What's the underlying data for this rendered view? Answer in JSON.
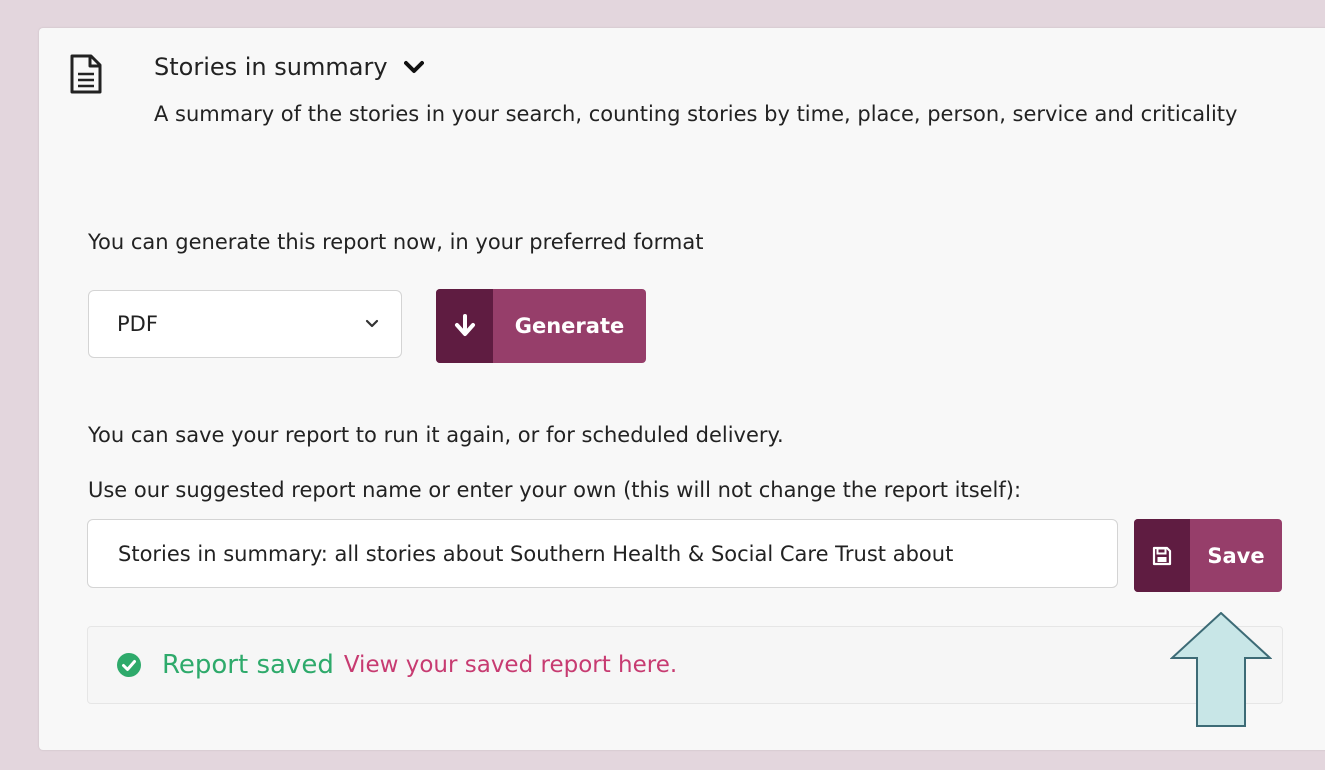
{
  "report": {
    "title": "Stories in summary",
    "description": "A summary of the stories in your search, counting stories by time, place, person, service and criticality",
    "icons": {
      "document": "document-icon",
      "toggle": "chevron-down-icon"
    }
  },
  "generate": {
    "intro": "You can generate this report now, in your preferred format",
    "format_selected": "PDF",
    "button_label": "Generate",
    "button_icon": "arrow-down-icon"
  },
  "save": {
    "intro": "You can save your report to run it again, or for scheduled delivery.",
    "name_prompt": "Use our suggested report name or enter your own (this will not change the report itself):",
    "name_value": "Stories in summary: all stories about Southern Health & Social Care Trust about",
    "button_label": "Save",
    "button_icon": "floppy-disk-icon"
  },
  "status": {
    "saved_text": "Report saved",
    "link_text": "View your saved report here.",
    "icon": "check-circle-icon"
  },
  "colors": {
    "page_bg": "#e3d6dd",
    "button_primary": "#963e6a",
    "button_icon_bg": "#5f1c41",
    "success": "#2eaa6b",
    "link": "#c73b71",
    "arrow_fill": "#c8e6e7"
  }
}
